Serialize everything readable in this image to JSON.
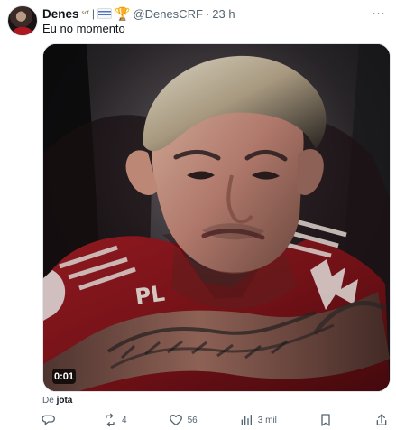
{
  "tweet": {
    "author": {
      "name": "Denes",
      "name_badges": "ˢᶜᶠ",
      "separator": "|",
      "handle": "@DenesCRF",
      "time": "23 h"
    },
    "more_options": "···",
    "text": "Eu no momento",
    "media": {
      "type": "video",
      "duration": "0:01",
      "attribution_prefix": "De",
      "attribution_author": "jota"
    },
    "actions": {
      "replies": "",
      "retweets": "4",
      "likes": "56",
      "views": "3 mil"
    }
  },
  "colors": {
    "text": "#0f1419",
    "secondary": "#536471",
    "border": "#dfe5ea",
    "jersey": "#7f141a"
  },
  "icons": {
    "reply": "reply-icon",
    "retweet": "retweet-icon",
    "like": "heart-icon",
    "views": "views-chart-icon",
    "bookmark": "bookmark-icon",
    "share": "share-icon"
  }
}
